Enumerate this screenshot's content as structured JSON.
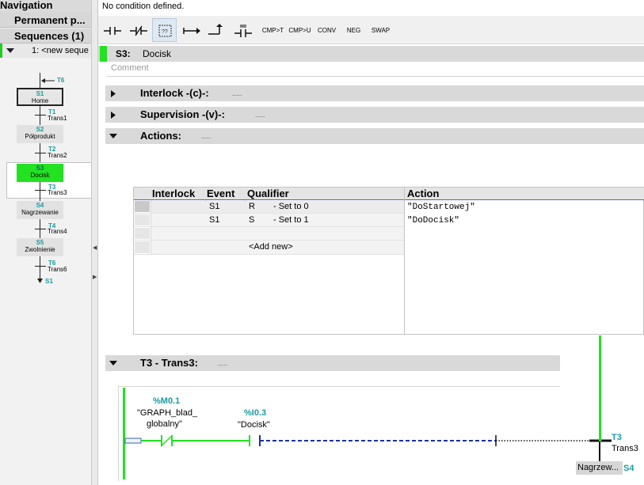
{
  "navigation": {
    "title": "Navigation",
    "tab_permanent": "Permanent p...",
    "tab_sequences": "Sequences (1)",
    "sequence_item": "1: <new seque",
    "overview": {
      "t6_top": "T6",
      "steps": [
        {
          "id": "S1",
          "name": "Home"
        },
        {
          "id": "S2",
          "name": "Półprodukt"
        },
        {
          "id": "S3",
          "name": "Docisk"
        },
        {
          "id": "S4",
          "name": "Nagrzewanie"
        },
        {
          "id": "S5",
          "name": "Zwolnienie"
        }
      ],
      "transitions": [
        {
          "id": "T1",
          "name": "Trans1"
        },
        {
          "id": "T2",
          "name": "Trans2"
        },
        {
          "id": "T3",
          "name": "Trans3"
        },
        {
          "id": "T4",
          "name": "Trans4"
        },
        {
          "id": "T6",
          "name": "Trans6"
        }
      ],
      "end_jump": "S1"
    }
  },
  "main": {
    "status_text": "No condition defined.",
    "toolbar": {
      "buttons": [
        "CMP>T",
        "CMP>U",
        "CONV",
        "NEG",
        "SWAP"
      ]
    },
    "step": {
      "id": "S3:",
      "name": "Docisk",
      "comment_placeholder": "Comment"
    },
    "sections": {
      "interlock": "Interlock -(c)-:",
      "supervision": "Supervision -(v)-:",
      "actions": "Actions:",
      "transition": "T3 - Trans3:",
      "dots": "....."
    },
    "actions_table": {
      "headers": [
        "Interlock",
        "Event",
        "Qualifier",
        "Action"
      ],
      "rows": [
        {
          "event": "S1",
          "qualifier": "R",
          "qualifier_desc": "- Set to 0",
          "action": "\"DoStartowej\""
        },
        {
          "event": "S1",
          "qualifier": "S",
          "qualifier_desc": "- Set to 1",
          "action": "\"DoDocisk\""
        }
      ],
      "add_new": "<Add new>"
    },
    "ladder": {
      "contact1_address": "%M0.1",
      "contact1_name_line1": "\"GRAPH_blad_",
      "contact1_name_line2": "globalny\"",
      "contact2_address": "%I0.3",
      "contact2_name": "\"Docisk\"",
      "transition_id": "T3",
      "transition_name": "Trans3",
      "next_step_name": "Nagrzew...",
      "next_step_id": "S4"
    }
  },
  "colors": {
    "active_green": "#22e222",
    "teal_label": "#1a9aa0",
    "wire_blue": "#1b2fa8"
  }
}
